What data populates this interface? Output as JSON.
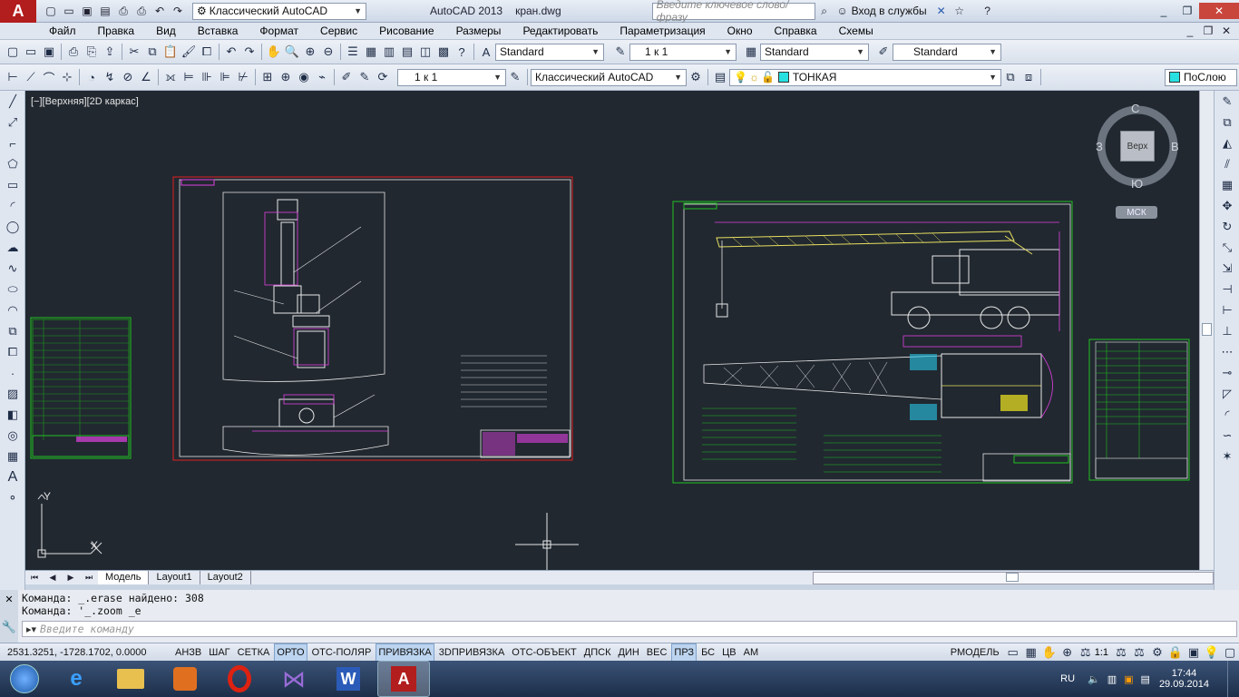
{
  "titlebar": {
    "workspace": "Классический AutoCAD",
    "app_title": "AutoCAD 2013",
    "file_title": "кран.dwg",
    "search_placeholder": "Введите ключевое слово/фразу",
    "signin": "Вход в службы"
  },
  "menu": [
    "Файл",
    "Правка",
    "Вид",
    "Вставка",
    "Формат",
    "Сервис",
    "Рисование",
    "Размеры",
    "Редактировать",
    "Параметризация",
    "Окно",
    "Справка",
    "Схемы"
  ],
  "toolbar2": {
    "text_style": "Standard",
    "dim_scale": "1 к 1",
    "dim_style": "Standard",
    "table_style": "Standard"
  },
  "toolbar3": {
    "scale": "1 к 1",
    "workspace": "Классический AutoCAD",
    "layer": "ТОНКАЯ",
    "color": "ПоСлою"
  },
  "viewport": {
    "label": "[−][Верхняя][2D каркас]",
    "compass": {
      "n": "С",
      "s": "Ю",
      "w": "З",
      "e": "В",
      "cube": "Верх",
      "ucs": "МСК"
    },
    "ucs_y": "Y",
    "ucs_x": "X"
  },
  "tabs": [
    "Модель",
    "Layout1",
    "Layout2"
  ],
  "command": {
    "line1": "Команда:  _.erase найдено: 308",
    "line2": "Команда: '_.zoom _e",
    "placeholder": "Введите команду"
  },
  "status": {
    "coords": "2531.3251, -1728.1702, 0.0000",
    "toggles": [
      {
        "label": "АНЗВ",
        "on": false
      },
      {
        "label": "ШАГ",
        "on": false
      },
      {
        "label": "СЕТКА",
        "on": false
      },
      {
        "label": "ОРТО",
        "on": true
      },
      {
        "label": "ОТС-ПОЛЯР",
        "on": false
      },
      {
        "label": "ПРИВЯЗКА",
        "on": true
      },
      {
        "label": "3DПРИВЯЗКА",
        "on": false
      },
      {
        "label": "ОТС-ОБЪЕКТ",
        "on": false
      },
      {
        "label": "ДПСК",
        "on": false
      },
      {
        "label": "ДИН",
        "on": false
      },
      {
        "label": "ВЕС",
        "on": false
      },
      {
        "label": "ПРЗ",
        "on": true
      },
      {
        "label": "БС",
        "on": false
      },
      {
        "label": "ЦВ",
        "on": false
      },
      {
        "label": "АМ",
        "on": false
      }
    ],
    "model_label": "РМОДЕЛЬ",
    "anno_scale": "1:1"
  },
  "taskbar": {
    "lang": "RU",
    "time": "17:44",
    "date": "29.09.2014"
  },
  "colors": {
    "viewport": "#212830",
    "green": "#20c020",
    "magenta": "#e040e0",
    "red": "#e02020",
    "yellow": "#e8e060"
  }
}
